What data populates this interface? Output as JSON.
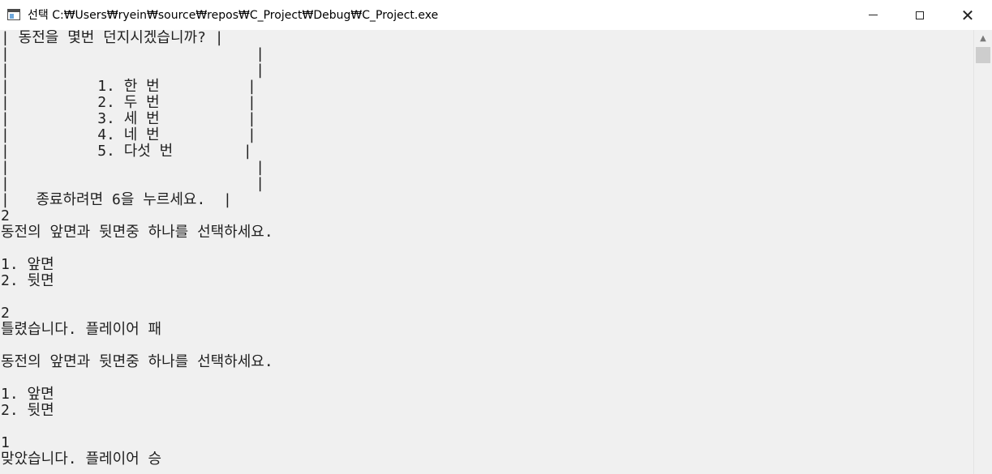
{
  "window": {
    "title": "선택 C:₩Users₩ryein₩source₩repos₩C_Project₩Debug₩C_Project.exe",
    "icon": "console-app-icon",
    "controls": {
      "minimize_icon": "minimize-icon",
      "maximize_icon": "maximize-icon",
      "close_icon": "close-icon",
      "close_glyph": "✕"
    }
  },
  "scrollbar": {
    "up_arrow": "▲"
  },
  "console": {
    "lines": [
      "| 동전을 몇번 던지시겠습니까? |",
      "|                            |",
      "|                            |",
      "|          1. 한 번          |",
      "|          2. 두 번          |",
      "|          3. 세 번          |",
      "|          4. 네 번          |",
      "|          5. 다섯 번        |",
      "|                            |",
      "|                            |",
      "|   종료하려면 6을 누르세요.  |",
      "2",
      "동전의 앞면과 뒷면중 하나를 선택하세요.",
      "",
      "1. 앞면",
      "2. 뒷면",
      "",
      "2",
      "틀렸습니다. 플레이어 패",
      "",
      "동전의 앞면과 뒷면중 하나를 선택하세요.",
      "",
      "1. 앞면",
      "2. 뒷면",
      "",
      "1",
      "맞았습니다. 플레이어 승"
    ]
  }
}
